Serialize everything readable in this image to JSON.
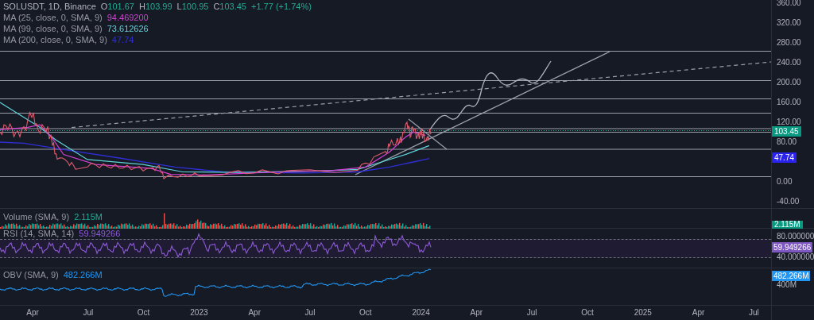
{
  "header": {
    "symbol": "SOLUSDT, 1D, Binance",
    "ohlc": [
      {
        "label": "O",
        "value": "101.67"
      },
      {
        "label": "H",
        "value": "103.99"
      },
      {
        "label": "L",
        "value": "100.95"
      },
      {
        "label": "C",
        "value": "103.45"
      }
    ],
    "change": "+1.77 (+1.74%)"
  },
  "indicators": [
    {
      "label": "MA (25, close, 0, SMA, 9)",
      "value": "94.469200",
      "color": "#d43fd4"
    },
    {
      "label": "MA (99, close, 0, SMA, 9)",
      "value": "73.612626",
      "color": "#5fd3d8"
    },
    {
      "label": "MA (200, close, 0, SMA, 9)",
      "value": "47.74",
      "color": "#2f2fd6"
    }
  ],
  "price_axis": {
    "ticks": [
      "360.00",
      "320.00",
      "280.00",
      "240.00",
      "200.00",
      "160.00",
      "120.00",
      "80.00",
      "0.00",
      "-40.00"
    ],
    "badges": [
      {
        "value": "103.45",
        "color": "#089981"
      },
      {
        "value": "47.74",
        "color": "#2a22ee"
      }
    ]
  },
  "volume": {
    "label": "Volume (SMA, 9)",
    "value": "2.115M",
    "badge": "2.115M"
  },
  "rsi": {
    "label": "RSI (14, SMA, 14)",
    "value": "59.949266",
    "ticks": [
      "80.000000",
      "40.000000"
    ],
    "badge": "59.949266"
  },
  "obv": {
    "label": "OBV (SMA, 9)",
    "value": "482.266M",
    "ticks": [
      "400M"
    ],
    "badge": "482.266M"
  },
  "time_axis": [
    "Apr",
    "Jul",
    "Oct",
    "2023",
    "Apr",
    "Jul",
    "Oct",
    "2024",
    "Apr",
    "Jul",
    "Oct",
    "2025",
    "Apr",
    "Jul"
  ]
}
